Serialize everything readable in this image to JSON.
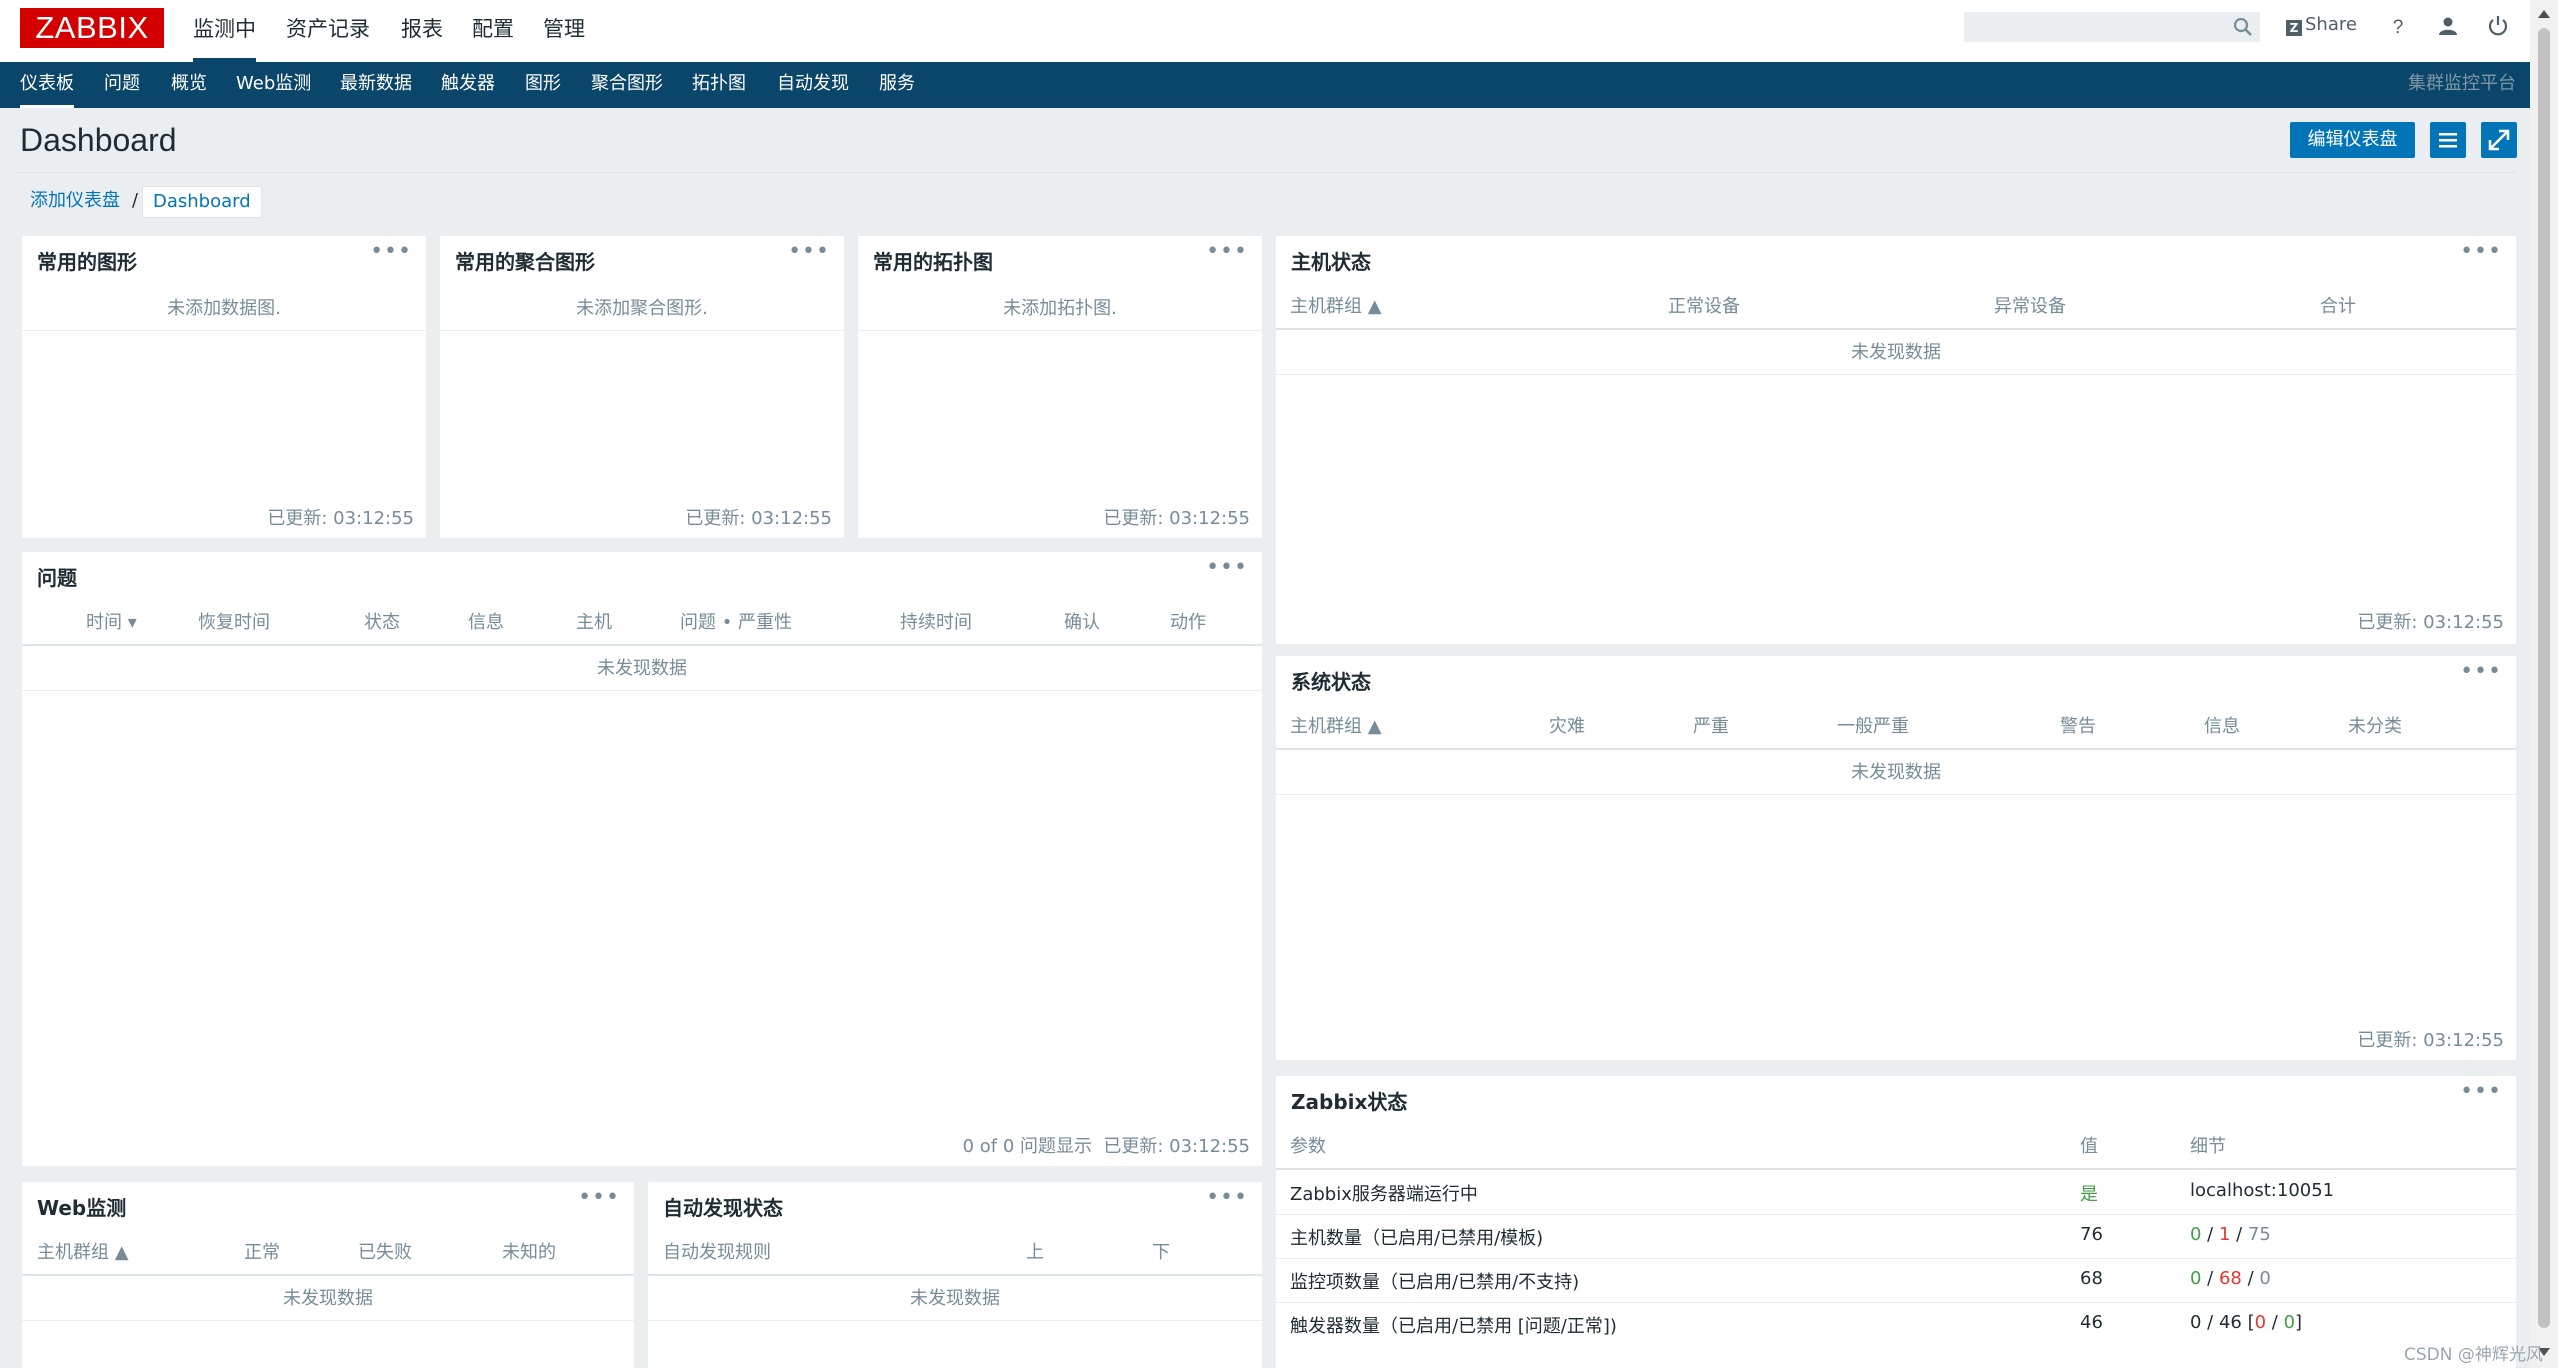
{
  "logo": "ZABBIX",
  "top_menu": [
    {
      "label": "监测中",
      "active": true
    },
    {
      "label": "资产记录"
    },
    {
      "label": "报表"
    },
    {
      "label": "配置"
    },
    {
      "label": "管理"
    }
  ],
  "topbar": {
    "search_placeholder": "",
    "share_label": "Share"
  },
  "nav": {
    "items": [
      "仪表板",
      "问题",
      "概览",
      "Web监测",
      "最新数据",
      "触发器",
      "图形",
      "聚合图形",
      "拓扑图",
      "自动发现",
      "服务"
    ],
    "right_label": "集群监控平台"
  },
  "header": {
    "title": "Dashboard",
    "edit_button": "编辑仪表盘"
  },
  "breadcrumb": {
    "parent": "添加仪表盘",
    "separator": "/",
    "current": "Dashboard"
  },
  "widgets": {
    "fav_graphs": {
      "title": "常用的图形",
      "message": "未添加数据图.",
      "updated": "已更新: 03:12:55"
    },
    "fav_screens": {
      "title": "常用的聚合图形",
      "message": "未添加聚合图形.",
      "updated": "已更新: 03:12:55"
    },
    "fav_maps": {
      "title": "常用的拓扑图",
      "message": "未添加拓扑图.",
      "updated": "已更新: 03:12:55"
    },
    "problems": {
      "title": "问题",
      "columns": [
        "时间 ▾",
        "恢复时间",
        "状态",
        "信息",
        "主机",
        "问题 • 严重性",
        "持续时间",
        "确认",
        "动作"
      ],
      "empty": "未发现数据",
      "summary": "0 of 0 问题显示",
      "updated": "已更新: 03:12:55"
    },
    "host_status": {
      "title": "主机状态",
      "columns": [
        "主机群组 ▲",
        "正常设备",
        "异常设备",
        "合计"
      ],
      "empty": "未发现数据",
      "updated": "已更新: 03:12:55"
    },
    "system_status": {
      "title": "系统状态",
      "columns": [
        "主机群组 ▲",
        "灾难",
        "严重",
        "一般严重",
        "警告",
        "信息",
        "未分类"
      ],
      "empty": "未发现数据",
      "updated": "已更新: 03:12:55"
    },
    "web_monitoring": {
      "title": "Web监测",
      "columns": [
        "主机群组 ▲",
        "正常",
        "已失败",
        "未知的"
      ],
      "empty": "未发现数据"
    },
    "discovery": {
      "title": "自动发现状态",
      "columns": [
        "自动发现规则",
        "上",
        "下"
      ],
      "empty": "未发现数据"
    },
    "zabbix_status": {
      "title": "Zabbix状态",
      "columns": [
        "参数",
        "值",
        "细节"
      ],
      "rows": [
        {
          "param": "Zabbix服务器端运行中",
          "value": "是",
          "detail": [
            {
              "t": "localhost:10051",
              "c": "normal"
            }
          ]
        },
        {
          "param": "主机数量（已启用/已禁用/模板)",
          "value": "76",
          "detail": [
            {
              "t": "0",
              "c": "green"
            },
            {
              "t": " / ",
              "c": "normal"
            },
            {
              "t": "1",
              "c": "red"
            },
            {
              "t": " / ",
              "c": "normal"
            },
            {
              "t": "75",
              "c": "grey"
            }
          ]
        },
        {
          "param": "监控项数量（已启用/已禁用/不支持)",
          "value": "68",
          "detail": [
            {
              "t": "0",
              "c": "green"
            },
            {
              "t": " / ",
              "c": "normal"
            },
            {
              "t": "68",
              "c": "red"
            },
            {
              "t": " / ",
              "c": "normal"
            },
            {
              "t": "0",
              "c": "grey"
            }
          ]
        },
        {
          "param": "触发器数量（已启用/已禁用 [问题/正常])",
          "value": "46",
          "detail": [
            {
              "t": "0 / 46 [",
              "c": "normal"
            },
            {
              "t": "0",
              "c": "red"
            },
            {
              "t": " / ",
              "c": "normal"
            },
            {
              "t": "0",
              "c": "green"
            },
            {
              "t": "]",
              "c": "normal"
            }
          ]
        }
      ]
    }
  },
  "watermark": "CSDN @神辉光风",
  "colors": {
    "brand_red": "#d40000",
    "nav_bg": "#0a466a",
    "button_blue": "#0275b8",
    "ok_green": "#429e47",
    "problem_red": "#e33734"
  }
}
